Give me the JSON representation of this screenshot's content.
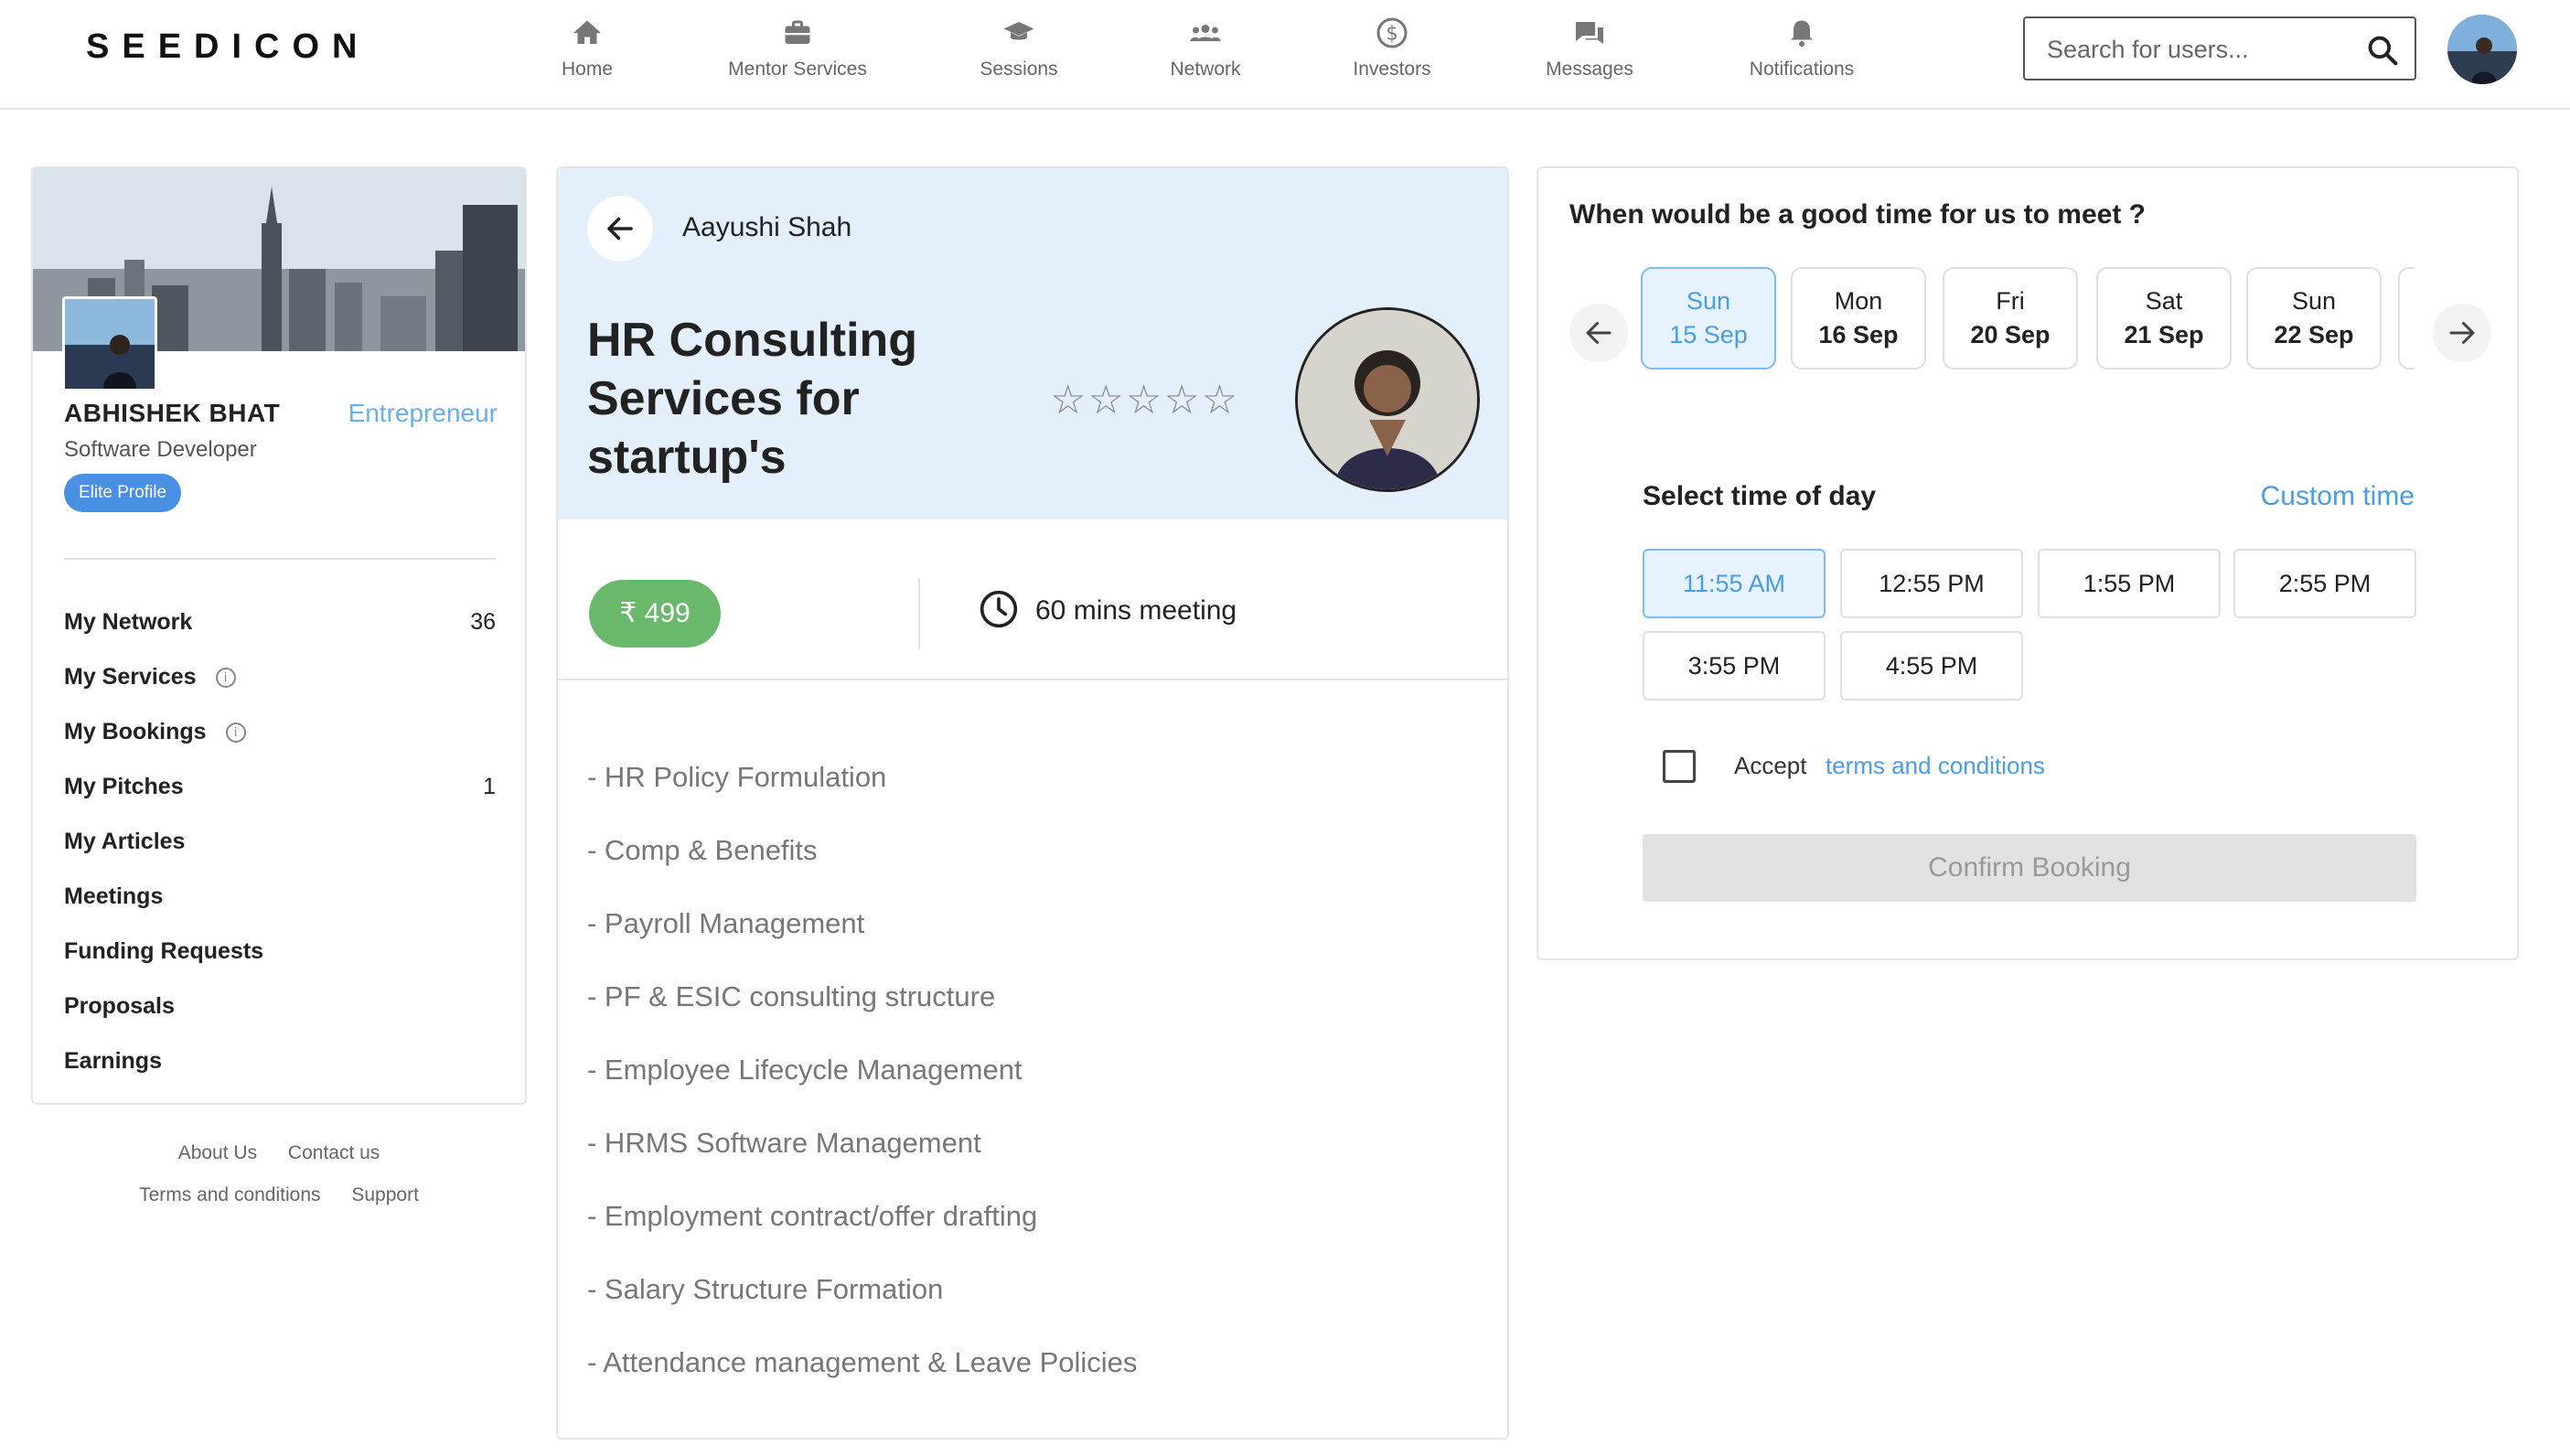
{
  "brand": {
    "logo": "SEEDICON"
  },
  "nav": {
    "items": [
      {
        "label": "Home",
        "icon": "home-icon"
      },
      {
        "label": "Mentor Services",
        "icon": "briefcase-icon"
      },
      {
        "label": "Sessions",
        "icon": "graduation-cap-icon"
      },
      {
        "label": "Network",
        "icon": "people-icon"
      },
      {
        "label": "Investors",
        "icon": "dollar-circle-icon"
      },
      {
        "label": "Messages",
        "icon": "chat-icon"
      },
      {
        "label": "Notifications",
        "icon": "bell-icon"
      }
    ]
  },
  "search": {
    "placeholder": "Search for users..."
  },
  "profile": {
    "name": "ABHISHEK BHAT",
    "role": "Entrepreneur",
    "title": "Software Developer",
    "badge": "Elite Profile",
    "menu": [
      {
        "label": "My Network",
        "count": "36"
      },
      {
        "label": "My Services",
        "info": "i"
      },
      {
        "label": "My Bookings",
        "info": "i"
      },
      {
        "label": "My Pitches",
        "count": "1"
      },
      {
        "label": "My Articles"
      },
      {
        "label": "Meetings"
      },
      {
        "label": "Funding Requests"
      },
      {
        "label": "Proposals"
      },
      {
        "label": "Earnings"
      }
    ]
  },
  "footer": {
    "about": "About Us",
    "contact": "Contact us",
    "terms": "Terms and conditions",
    "support": "Support"
  },
  "service": {
    "mentor_name": "Aayushi Shah",
    "title": "HR Consulting Services for startup's",
    "rating_stars": "☆☆☆☆☆",
    "price": "₹ 499",
    "duration": "60 mins meeting",
    "items": [
      "- HR Policy Formulation",
      "- Comp & Benefits",
      "- Payroll Management",
      "- PF & ESIC consulting structure",
      "- Employee Lifecycle Management",
      "- HRMS Software Management",
      "- Employment contract/offer drafting",
      "- Salary Structure Formation",
      "- Attendance management & Leave Policies"
    ]
  },
  "booking": {
    "question": "When would be a good time for us to meet ?",
    "dates": [
      {
        "day": "Sun",
        "date": "15 Sep",
        "selected": true
      },
      {
        "day": "Mon",
        "date": "16 Sep"
      },
      {
        "day": "Fri",
        "date": "20 Sep"
      },
      {
        "day": "Sat",
        "date": "21 Sep"
      },
      {
        "day": "Sun",
        "date": "22 Sep"
      }
    ],
    "time_label": "Select time of day",
    "custom_time": "Custom time",
    "slots": [
      "11:55 AM",
      "12:55 PM",
      "1:55 PM",
      "2:55 PM",
      "3:55 PM",
      "4:55 PM"
    ],
    "selected_slot": "11:55 AM",
    "accept": "Accept",
    "terms_link": "terms and conditions",
    "confirm": "Confirm Booking"
  },
  "colors": {
    "accent": "#4a9ce6",
    "price_green": "#6ab86c",
    "header_bg": "#e3f0fb"
  }
}
